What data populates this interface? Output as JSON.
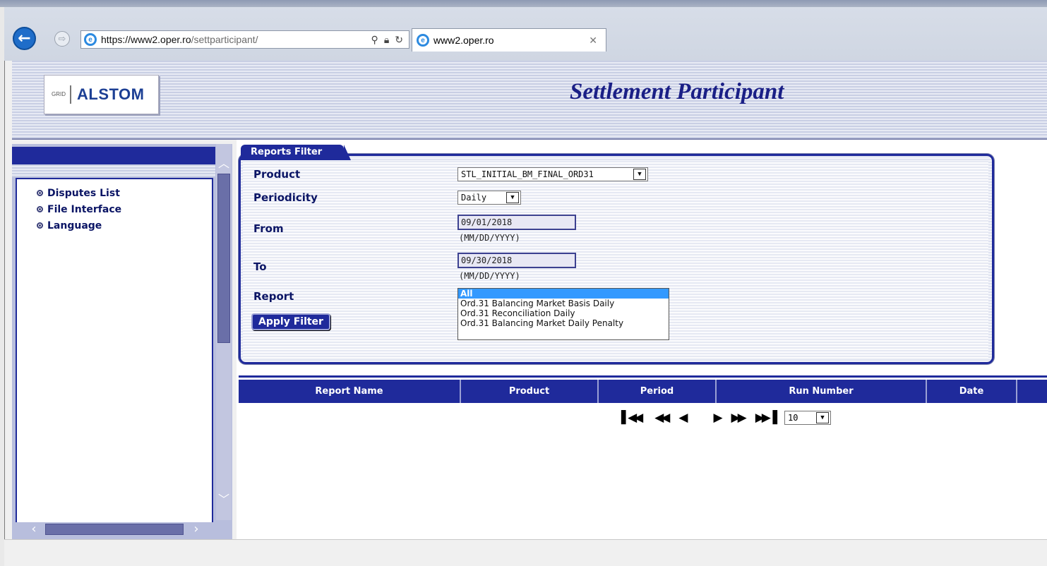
{
  "browser": {
    "url_domain": "https://www2.oper.ro",
    "url_path": "/settparticipant/",
    "tab_title": "www2.oper.ro"
  },
  "header": {
    "logo_grid": "GRID",
    "logo_brand": "ALSTOM",
    "title": "Settlement Participant"
  },
  "sidebar": {
    "items": [
      {
        "label": "Disputes List"
      },
      {
        "label": "File Interface"
      },
      {
        "label": "Language"
      }
    ]
  },
  "filter": {
    "tab_label": "Reports Filter",
    "product_label": "Product",
    "product_value": "STL_INITIAL_BM_FINAL_ORD31",
    "periodicity_label": "Periodicity",
    "periodicity_value": "Daily",
    "from_label": "From",
    "from_value": "09/01/2018",
    "from_hint": "(MM/DD/YYYY)",
    "to_label": "To",
    "to_value": "09/30/2018",
    "to_hint": "(MM/DD/YYYY)",
    "report_label": "Report",
    "report_options": [
      "All",
      "Ord.31 Balancing Market Basis Daily",
      "Ord.31 Reconciliation Daily",
      "Ord.31 Balancing Market Daily Penalty"
    ],
    "report_selected": "All",
    "apply_label": "Apply Filter"
  },
  "table": {
    "columns": [
      "Report Name",
      "Product",
      "Period",
      "Run Number",
      "Date",
      ""
    ]
  },
  "pager": {
    "page_size": "10"
  },
  "colors": {
    "navy": "#1f2a9b",
    "title": "#1a1f86",
    "selection": "#3399ff"
  }
}
